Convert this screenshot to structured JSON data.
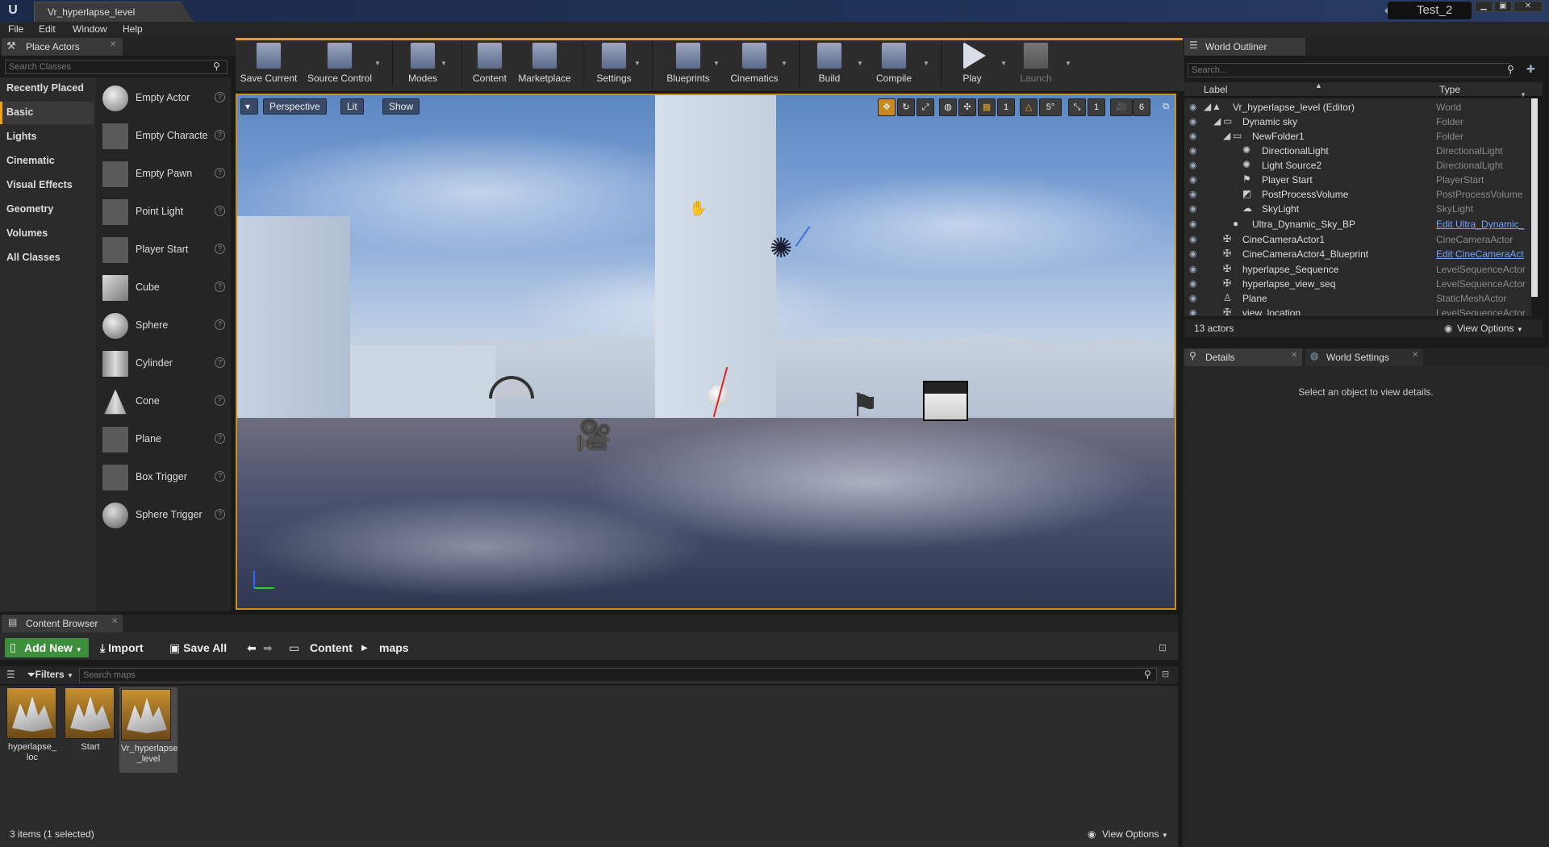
{
  "window": {
    "doc_tab": "Vr_hyperlapse_level",
    "project": "Test_2",
    "logo": "U"
  },
  "menu": [
    "File",
    "Edit",
    "Window",
    "Help"
  ],
  "place_actors": {
    "tab_label": "Place Actors",
    "search_placeholder": "Search Classes",
    "categories": [
      "Recently Placed",
      "Basic",
      "Lights",
      "Cinematic",
      "Visual Effects",
      "Geometry",
      "Volumes",
      "All Classes"
    ],
    "active_category": "Basic",
    "items": [
      "Empty Actor",
      "Empty Characte",
      "Empty Pawn",
      "Point Light",
      "Player Start",
      "Cube",
      "Sphere",
      "Cylinder",
      "Cone",
      "Plane",
      "Box Trigger",
      "Sphere Trigger"
    ]
  },
  "toolbar": {
    "buttons": [
      "Save Current",
      "Source Control",
      "Modes",
      "Content",
      "Marketplace",
      "Settings",
      "Blueprints",
      "Cinematics",
      "Build",
      "Compile",
      "Play",
      "Launch"
    ]
  },
  "viewport": {
    "perspective_label": "Perspective",
    "lit_label": "Lit",
    "show_label": "Show",
    "grid_snap": "1",
    "rot_snap": "5°",
    "scale_snap": "1",
    "cam_speed": "6"
  },
  "world_outliner": {
    "tab_label": "World Outliner",
    "search_placeholder": "Search...",
    "col_label": "Label",
    "col_type": "Type",
    "rows": [
      {
        "label": "Vr_hyperlapse_level (Editor)",
        "type": "World",
        "link": false
      },
      {
        "label": "Dynamic sky",
        "type": "Folder",
        "link": false
      },
      {
        "label": "NewFolder1",
        "type": "Folder",
        "link": false
      },
      {
        "label": "DirectionalLight",
        "type": "DirectionalLight",
        "link": false
      },
      {
        "label": "Light Source2",
        "type": "DirectionalLight",
        "link": false
      },
      {
        "label": "Player Start",
        "type": "PlayerStart",
        "link": false
      },
      {
        "label": "PostProcessVolume",
        "type": "PostProcessVolume",
        "link": false
      },
      {
        "label": "SkyLight",
        "type": "SkyLight",
        "link": false
      },
      {
        "label": "Ultra_Dynamic_Sky_BP",
        "type": "Edit Ultra_Dynamic_",
        "link": true
      },
      {
        "label": "CineCameraActor1",
        "type": "CineCameraActor",
        "link": false
      },
      {
        "label": "CineCameraActor4_Blueprint",
        "type": "Edit CineCameraAct",
        "link": true
      },
      {
        "label": "hyperlapse_Sequence",
        "type": "LevelSequenceActor",
        "link": false
      },
      {
        "label": "hyperlapse_view_seq",
        "type": "LevelSequenceActor",
        "link": false
      },
      {
        "label": "Plane",
        "type": "StaticMeshActor",
        "link": false
      },
      {
        "label": "view_location",
        "type": "LevelSequenceActor",
        "link": false
      }
    ],
    "count": "13 actors",
    "view_options": "View Options"
  },
  "details": {
    "tab_details": "Details",
    "tab_world_settings": "World Settings",
    "message": "Select an object to view details."
  },
  "content_browser": {
    "tab_label": "Content Browser",
    "add_new": "Add New",
    "import": "Import",
    "save_all": "Save All",
    "path": [
      "Content",
      "maps"
    ],
    "filters": "Filters",
    "search_placeholder": "Search maps",
    "assets": [
      {
        "name": "hyperlapse_\nloc",
        "selected": false
      },
      {
        "name": "Start",
        "selected": false
      },
      {
        "name": "Vr_hyperlapse\n_level",
        "selected": true
      }
    ],
    "status": "3 items (1 selected)",
    "view_options": "View Options"
  }
}
